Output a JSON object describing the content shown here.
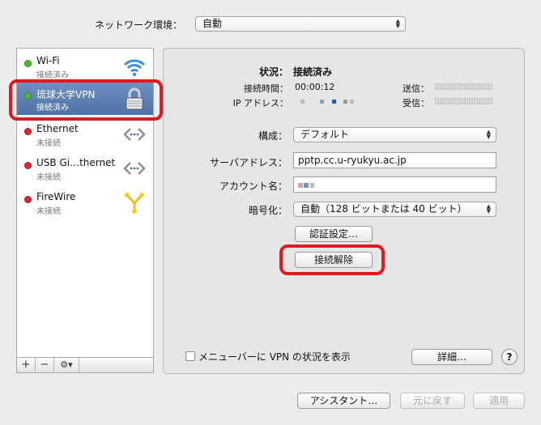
{
  "location": {
    "label": "ネットワーク環境：",
    "value": "自動"
  },
  "sidebar": {
    "services": [
      {
        "name": "Wi-Fi",
        "status": "接続済み",
        "dot": "#4cb733",
        "icon": "wifi-icon"
      },
      {
        "name": "琉球大学VPN",
        "status": "接続済み",
        "dot": "#4cb733",
        "icon": "lock-icon"
      },
      {
        "name": "Ethernet",
        "status": "未接続",
        "dot": "#d6282d",
        "icon": "ethernet-icon"
      },
      {
        "name": "USB Gi…thernet",
        "status": "未接続",
        "dot": "#d6282d",
        "icon": "ethernet-icon"
      },
      {
        "name": "FireWire",
        "status": "未接続",
        "dot": "#d6282d",
        "icon": "firewire-icon"
      }
    ],
    "toolbar": {
      "add": "+",
      "remove": "−",
      "gear": "⚙▾"
    }
  },
  "status": {
    "label": "状況：",
    "value": "接続済み",
    "time_label": "接続時間：",
    "time_value": "00:00:12",
    "ip_label": "IP アドレス：",
    "sent_label": "送信：",
    "received_label": "受信："
  },
  "config": {
    "label": "構成：",
    "value": "デフォルト"
  },
  "server": {
    "label": "サーバアドレス：",
    "value": "pptp.cc.u-ryukyu.ac.jp"
  },
  "account": {
    "label": "アカウント名："
  },
  "encryption": {
    "label": "暗号化：",
    "value": "自動（128 ビットまたは 40 ビット）"
  },
  "buttons": {
    "auth": "認証設定…",
    "disconnect": "接続解除",
    "show_status": "メニューバーに VPN の状況を表示",
    "advanced": "詳細…",
    "help": "?",
    "assistant": "アシスタント…",
    "revert": "元に戻す",
    "apply": "適用"
  },
  "colors": {
    "highlight_ring": "#e01a22",
    "selection": "#5a7db3"
  }
}
